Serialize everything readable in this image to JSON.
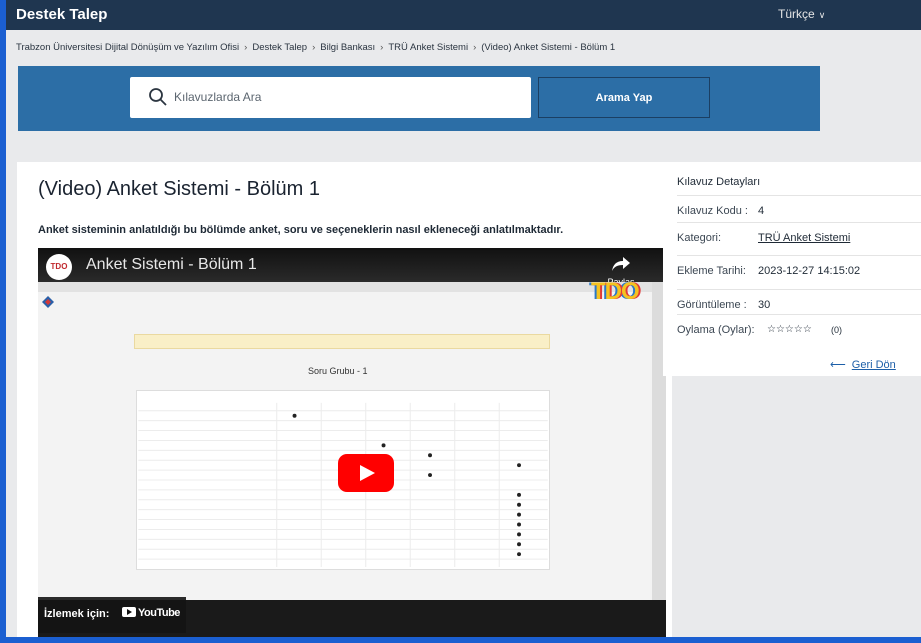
{
  "header": {
    "brand": "Destek Talep",
    "language": "Türkçe"
  },
  "breadcrumb": [
    "Trabzon Üniversitesi Dijital Dönüşüm ve Yazılım Ofisi",
    "Destek Talep",
    "Bilgi Bankası",
    "TRÜ Anket Sistemi",
    "(Video) Anket Sistemi - Bölüm 1"
  ],
  "search": {
    "placeholder": "Kılavuzlarda Ara",
    "button_label": "Arama Yap"
  },
  "article": {
    "title": "(Video) Anket Sistemi - Bölüm 1",
    "description": "Anket sisteminin anlatıldığı bu bölümde anket, soru ve seçeneklerin nasıl ekleneceği anlatılmaktadır.",
    "video": {
      "channel_logo": "TDO",
      "title": "Anket Sistemi - Bölüm 1",
      "share_label": "Paylaş",
      "screen_heading": "Soru Grubu - 1",
      "watch_label": "İzlemek için:",
      "youtube_label": "YouTube"
    }
  },
  "details": {
    "title": "Kılavuz Detayları",
    "code_label": "Kılavuz Kodu :",
    "code_value": "4",
    "category_label": "Kategori:",
    "category_value": "TRÜ Anket Sistemi",
    "date_label": "Ekleme Tarihi:",
    "date_value": "2023-12-27 14:15:02",
    "views_label": "Görüntüleme :",
    "views_value": "30",
    "rating_label": "Oylama (Oylar):",
    "rating_stars": "☆☆☆☆☆",
    "rating_count": "(0)",
    "back_label": "Geri Dön"
  },
  "colors": {
    "topbar": "#1f3650",
    "search_band": "#2c6ea6",
    "link": "#1d5fa8"
  }
}
